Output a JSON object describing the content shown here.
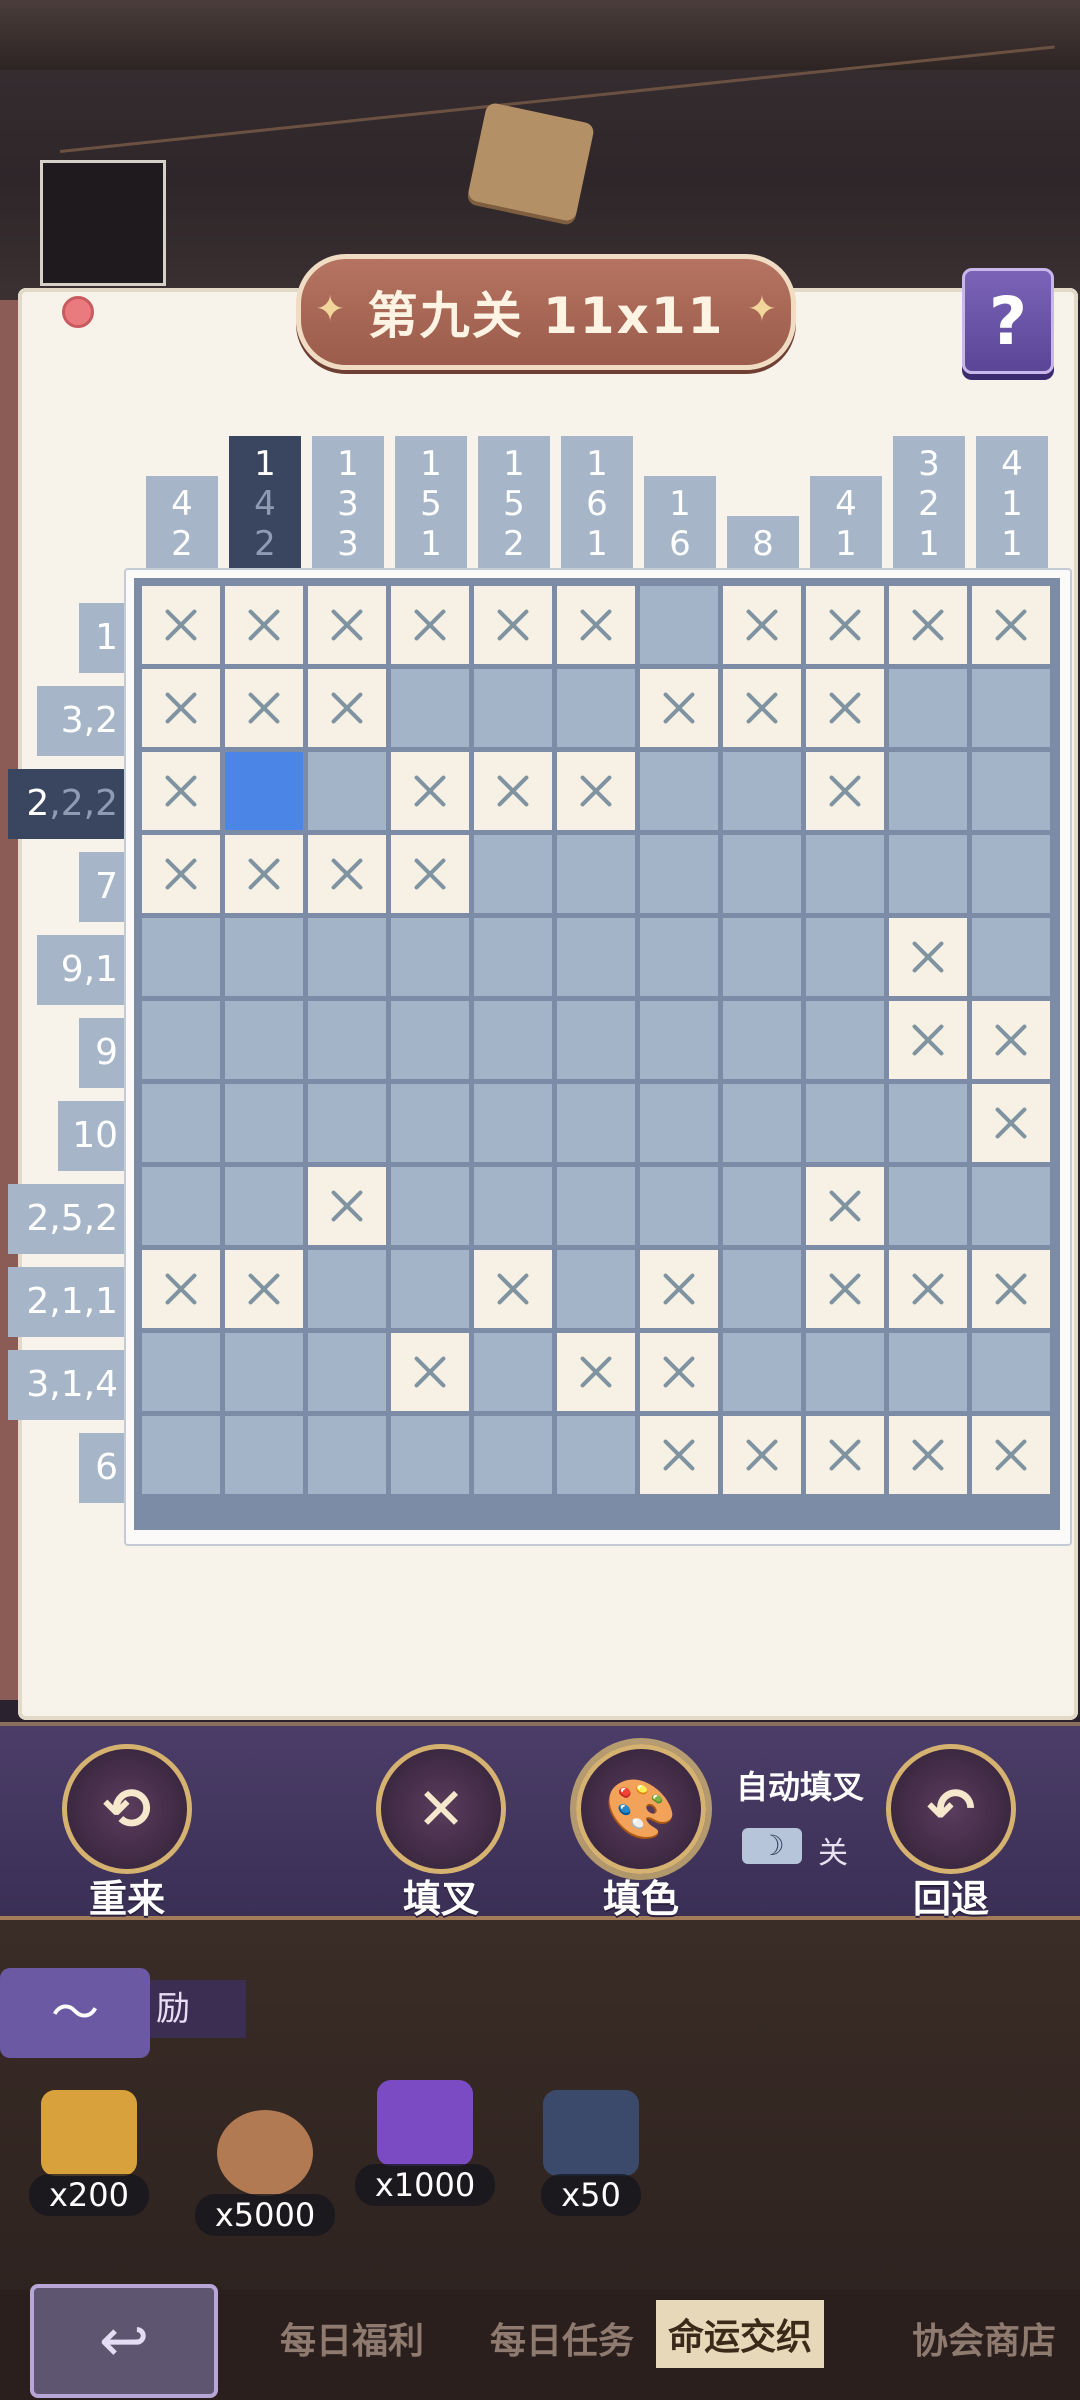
{
  "level": {
    "title": "第九关 11x11"
  },
  "help_icon": "?",
  "column_clues": [
    [
      "4",
      "2"
    ],
    [
      "1",
      "4",
      "2"
    ],
    [
      "1",
      "3",
      "3"
    ],
    [
      "1",
      "5",
      "1"
    ],
    [
      "1",
      "5",
      "2"
    ],
    [
      "1",
      "6",
      "1"
    ],
    [
      "1",
      "6"
    ],
    [
      "8"
    ],
    [
      "4",
      "1"
    ],
    [
      "3",
      "2",
      "1"
    ],
    [
      "4",
      "1",
      "1"
    ]
  ],
  "active_column": 1,
  "row_clues": [
    "1",
    "3,2",
    "2,2,2",
    "7",
    "9,1",
    "9",
    "10",
    "2,5,2",
    "2,1,1",
    "3,1,4",
    "6"
  ],
  "active_row": 2,
  "grid": [
    "XXXXXX.XXXX",
    "XXX...XXX..",
    "XF.XXX..X..",
    "XXXX.......",
    ".........X.",
    ".........XX",
    "..........X",
    "..X.....X..",
    "XX..X.X.XXX",
    "...X.XX....",
    "......XXXXX"
  ],
  "toolbar": {
    "restart": "重来",
    "cross": "填叉",
    "fill": "填色",
    "undo": "回退",
    "auto_fill_label": "自动填叉",
    "auto_fill_state": "关"
  },
  "rewards": [
    {
      "count": "x200"
    },
    {
      "count": "x5000"
    },
    {
      "count": "x1000"
    },
    {
      "count": "x50"
    }
  ],
  "reward_section_label": "励",
  "tabs": [
    "每日福利",
    "每日任务",
    "命运交织",
    "协会商店"
  ],
  "active_tab": 2
}
